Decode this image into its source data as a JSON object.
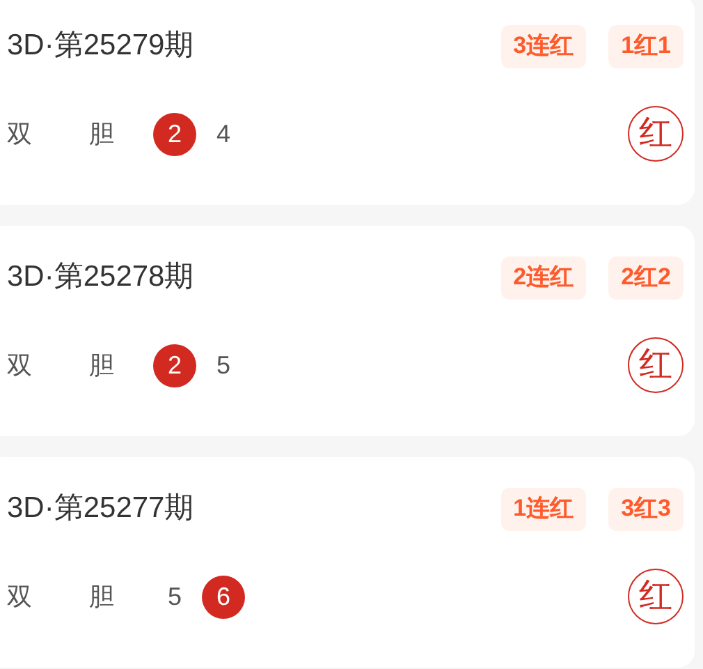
{
  "cards": [
    {
      "title": "3D·第25279期",
      "badges": [
        "3连红",
        "1红1"
      ],
      "labels": [
        "双",
        "胆"
      ],
      "numbers": [
        {
          "value": "2",
          "highlighted": true
        },
        {
          "value": "4",
          "highlighted": false
        }
      ],
      "result": "红"
    },
    {
      "title": "3D·第25278期",
      "badges": [
        "2连红",
        "2红2"
      ],
      "labels": [
        "双",
        "胆"
      ],
      "numbers": [
        {
          "value": "2",
          "highlighted": true
        },
        {
          "value": "5",
          "highlighted": false
        }
      ],
      "result": "红"
    },
    {
      "title": "3D·第25277期",
      "badges": [
        "1连红",
        "3红3"
      ],
      "labels": [
        "双",
        "胆"
      ],
      "numbers": [
        {
          "value": "5",
          "highlighted": false
        },
        {
          "value": "6",
          "highlighted": true
        }
      ],
      "result": "红"
    }
  ]
}
